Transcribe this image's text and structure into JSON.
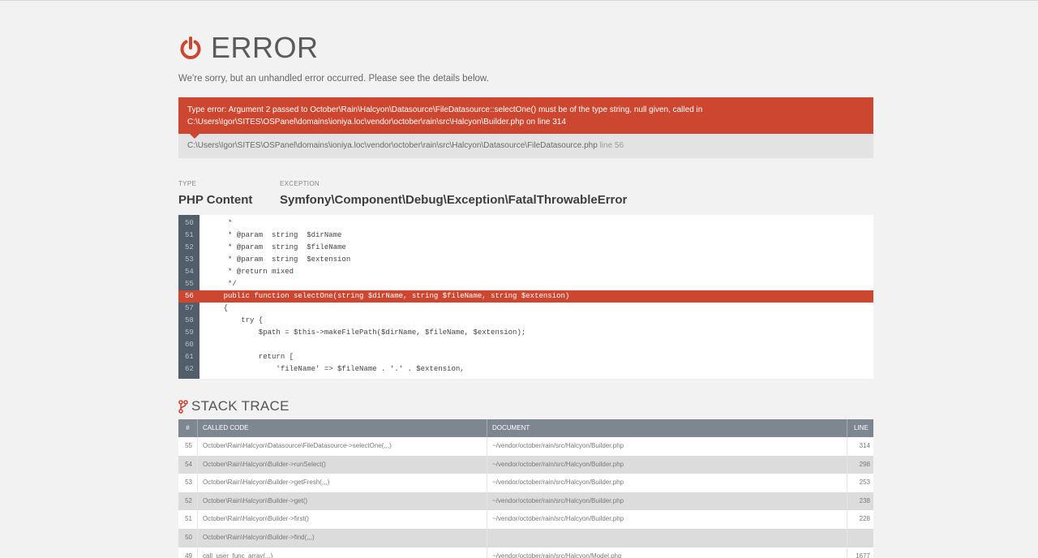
{
  "header": {
    "title": "ERROR",
    "subtitle": "We're sorry, but an unhandled error occurred. Please see the details below.",
    "icon": "power-icon",
    "accent": "#cd4630"
  },
  "error": {
    "message_line1": "Type error: Argument 2 passed to October\\Rain\\Halcyon\\Datasource\\FileDatasource::selectOne() must be of the type string, null given, called in",
    "message_line2": "C:\\Users\\Igor\\SITES\\OSPanel\\domains\\ioniya.loc\\vendor\\october\\rain\\src\\Halcyon\\Builder.php on line 314",
    "file": "C:\\Users\\Igor\\SITES\\OSPanel\\domains\\ioniya.loc\\vendor\\october\\rain\\src\\Halcyon\\Datasource\\FileDatasource.php",
    "line_label": "line 56"
  },
  "details": {
    "type_label": "TYPE",
    "type_value": "PHP Content",
    "exception_label": "EXCEPTION",
    "exception_value": "Symfony\\Component\\Debug\\Exception\\FatalThrowableError"
  },
  "code": {
    "highlight_line": "56",
    "lines": [
      {
        "num": "50",
        "text": "     *"
      },
      {
        "num": "51",
        "text": "     * @param  string  $dirName"
      },
      {
        "num": "52",
        "text": "     * @param  string  $fileName"
      },
      {
        "num": "53",
        "text": "     * @param  string  $extension"
      },
      {
        "num": "54",
        "text": "     * @return mixed"
      },
      {
        "num": "55",
        "text": "     */"
      },
      {
        "num": "56",
        "text": "    public function selectOne(string $dirName, string $fileName, string $extension)"
      },
      {
        "num": "57",
        "text": "    {"
      },
      {
        "num": "58",
        "text": "        try {"
      },
      {
        "num": "59",
        "text": "            $path = $this->makeFilePath($dirName, $fileName, $extension);"
      },
      {
        "num": "60",
        "text": ""
      },
      {
        "num": "61",
        "text": "            return ["
      },
      {
        "num": "62",
        "text": "                'fileName' => $fileName . '.' . $extension,"
      }
    ]
  },
  "stack": {
    "title": "STACK TRACE",
    "icon": "code-branch-icon",
    "columns": [
      "#",
      "CALLED CODE",
      "DOCUMENT",
      "LINE"
    ],
    "rows": [
      {
        "num": "55",
        "code": "October\\Rain\\Halcyon\\Datasource\\FileDatasource->selectOne(,,,)",
        "doc": "~/vendor/october/rain/src/Halcyon/Builder.php",
        "line": "314"
      },
      {
        "num": "54",
        "code": "October\\Rain\\Halcyon\\Builder->runSelect()",
        "doc": "~/vendor/october/rain/src/Halcyon/Builder.php",
        "line": "298"
      },
      {
        "num": "53",
        "code": "October\\Rain\\Halcyon\\Builder->getFresh(,,,)",
        "doc": "~/vendor/october/rain/src/Halcyon/Builder.php",
        "line": "253"
      },
      {
        "num": "52",
        "code": "October\\Rain\\Halcyon\\Builder->get()",
        "doc": "~/vendor/october/rain/src/Halcyon/Builder.php",
        "line": "238"
      },
      {
        "num": "51",
        "code": "October\\Rain\\Halcyon\\Builder->first()",
        "doc": "~/vendor/october/rain/src/Halcyon/Builder.php",
        "line": "228"
      },
      {
        "num": "50",
        "code": "October\\Rain\\Halcyon\\Builder->find(,,,)",
        "doc": "",
        "line": ""
      },
      {
        "num": "49",
        "code": "call_user_func_array(,,,)",
        "doc": "~/vendor/october/rain/src/Halcyon/Model.php",
        "line": "1677"
      }
    ]
  }
}
